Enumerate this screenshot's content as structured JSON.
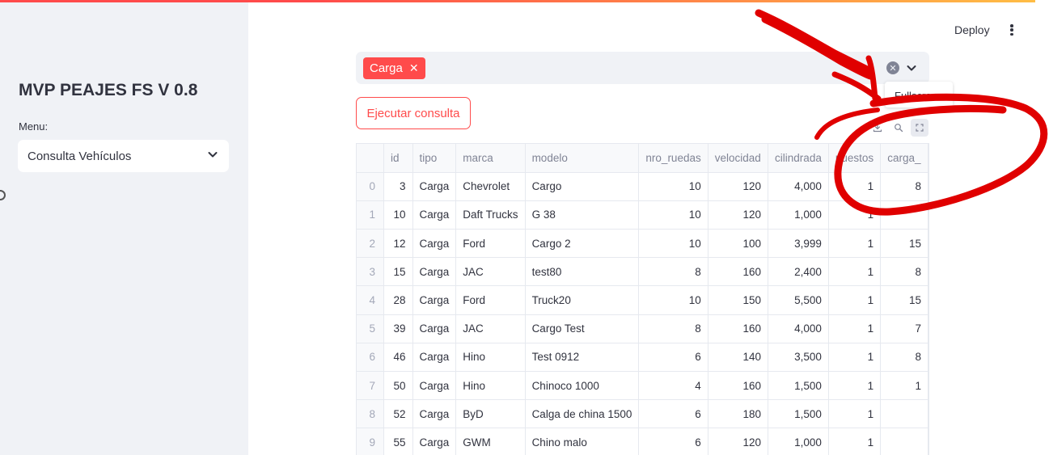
{
  "header": {
    "deploy_label": "Deploy"
  },
  "sidebar": {
    "title": "MVP PEAJES FS V 0.8",
    "menu_label": "Menu:",
    "menu_selected": "Consulta Vehículos"
  },
  "filter": {
    "tags": [
      {
        "label": "Carga"
      }
    ]
  },
  "actions": {
    "execute_label": "Ejecutar consulta"
  },
  "toolbar": {
    "tooltip": "Fullscreen",
    "icons": [
      "download-icon",
      "search-icon",
      "fullscreen-icon"
    ]
  },
  "table": {
    "columns": [
      "",
      "id",
      "tipo",
      "marca",
      "modelo",
      "nro_ruedas",
      "velocidad",
      "cilindrada",
      "puestos",
      "carga_"
    ],
    "rows": [
      {
        "idx": "0",
        "id": "3",
        "tipo": "Carga",
        "marca": "Chevrolet",
        "modelo": "Cargo",
        "nro_ruedas": "10",
        "velocidad": "120",
        "cilindrada": "4,000",
        "puestos": "1",
        "carga": "8"
      },
      {
        "idx": "1",
        "id": "10",
        "tipo": "Carga",
        "marca": "Daft Trucks",
        "modelo": "G 38",
        "nro_ruedas": "10",
        "velocidad": "120",
        "cilindrada": "1,000",
        "puestos": "1",
        "carga": ""
      },
      {
        "idx": "2",
        "id": "12",
        "tipo": "Carga",
        "marca": "Ford",
        "modelo": "Cargo 2",
        "nro_ruedas": "10",
        "velocidad": "100",
        "cilindrada": "3,999",
        "puestos": "1",
        "carga": "15"
      },
      {
        "idx": "3",
        "id": "15",
        "tipo": "Carga",
        "marca": "JAC",
        "modelo": "test80",
        "nro_ruedas": "8",
        "velocidad": "160",
        "cilindrada": "2,400",
        "puestos": "1",
        "carga": "8"
      },
      {
        "idx": "4",
        "id": "28",
        "tipo": "Carga",
        "marca": "Ford",
        "modelo": "Truck20",
        "nro_ruedas": "10",
        "velocidad": "150",
        "cilindrada": "5,500",
        "puestos": "1",
        "carga": "15"
      },
      {
        "idx": "5",
        "id": "39",
        "tipo": "Carga",
        "marca": "JAC",
        "modelo": "Cargo Test",
        "nro_ruedas": "8",
        "velocidad": "160",
        "cilindrada": "4,000",
        "puestos": "1",
        "carga": "7"
      },
      {
        "idx": "6",
        "id": "46",
        "tipo": "Carga",
        "marca": "Hino",
        "modelo": "Test 0912",
        "nro_ruedas": "6",
        "velocidad": "140",
        "cilindrada": "3,500",
        "puestos": "1",
        "carga": "8"
      },
      {
        "idx": "7",
        "id": "50",
        "tipo": "Carga",
        "marca": "Hino",
        "modelo": "Chinoco 1000",
        "nro_ruedas": "4",
        "velocidad": "160",
        "cilindrada": "1,500",
        "puestos": "1",
        "carga": "1"
      },
      {
        "idx": "8",
        "id": "52",
        "tipo": "Carga",
        "marca": "ByD",
        "modelo": "Calga de china 1500",
        "nro_ruedas": "6",
        "velocidad": "180",
        "cilindrada": "1,500",
        "puestos": "1",
        "carga": ""
      },
      {
        "idx": "9",
        "id": "55",
        "tipo": "Carga",
        "marca": "GWM",
        "modelo": "Chino malo",
        "nro_ruedas": "6",
        "velocidad": "120",
        "cilindrada": "1,000",
        "puestos": "1",
        "carga": ""
      }
    ]
  },
  "colors": {
    "accent": "#ff4b4b",
    "sidebar_bg": "#f0f2f6",
    "annotation": "#e00000"
  }
}
